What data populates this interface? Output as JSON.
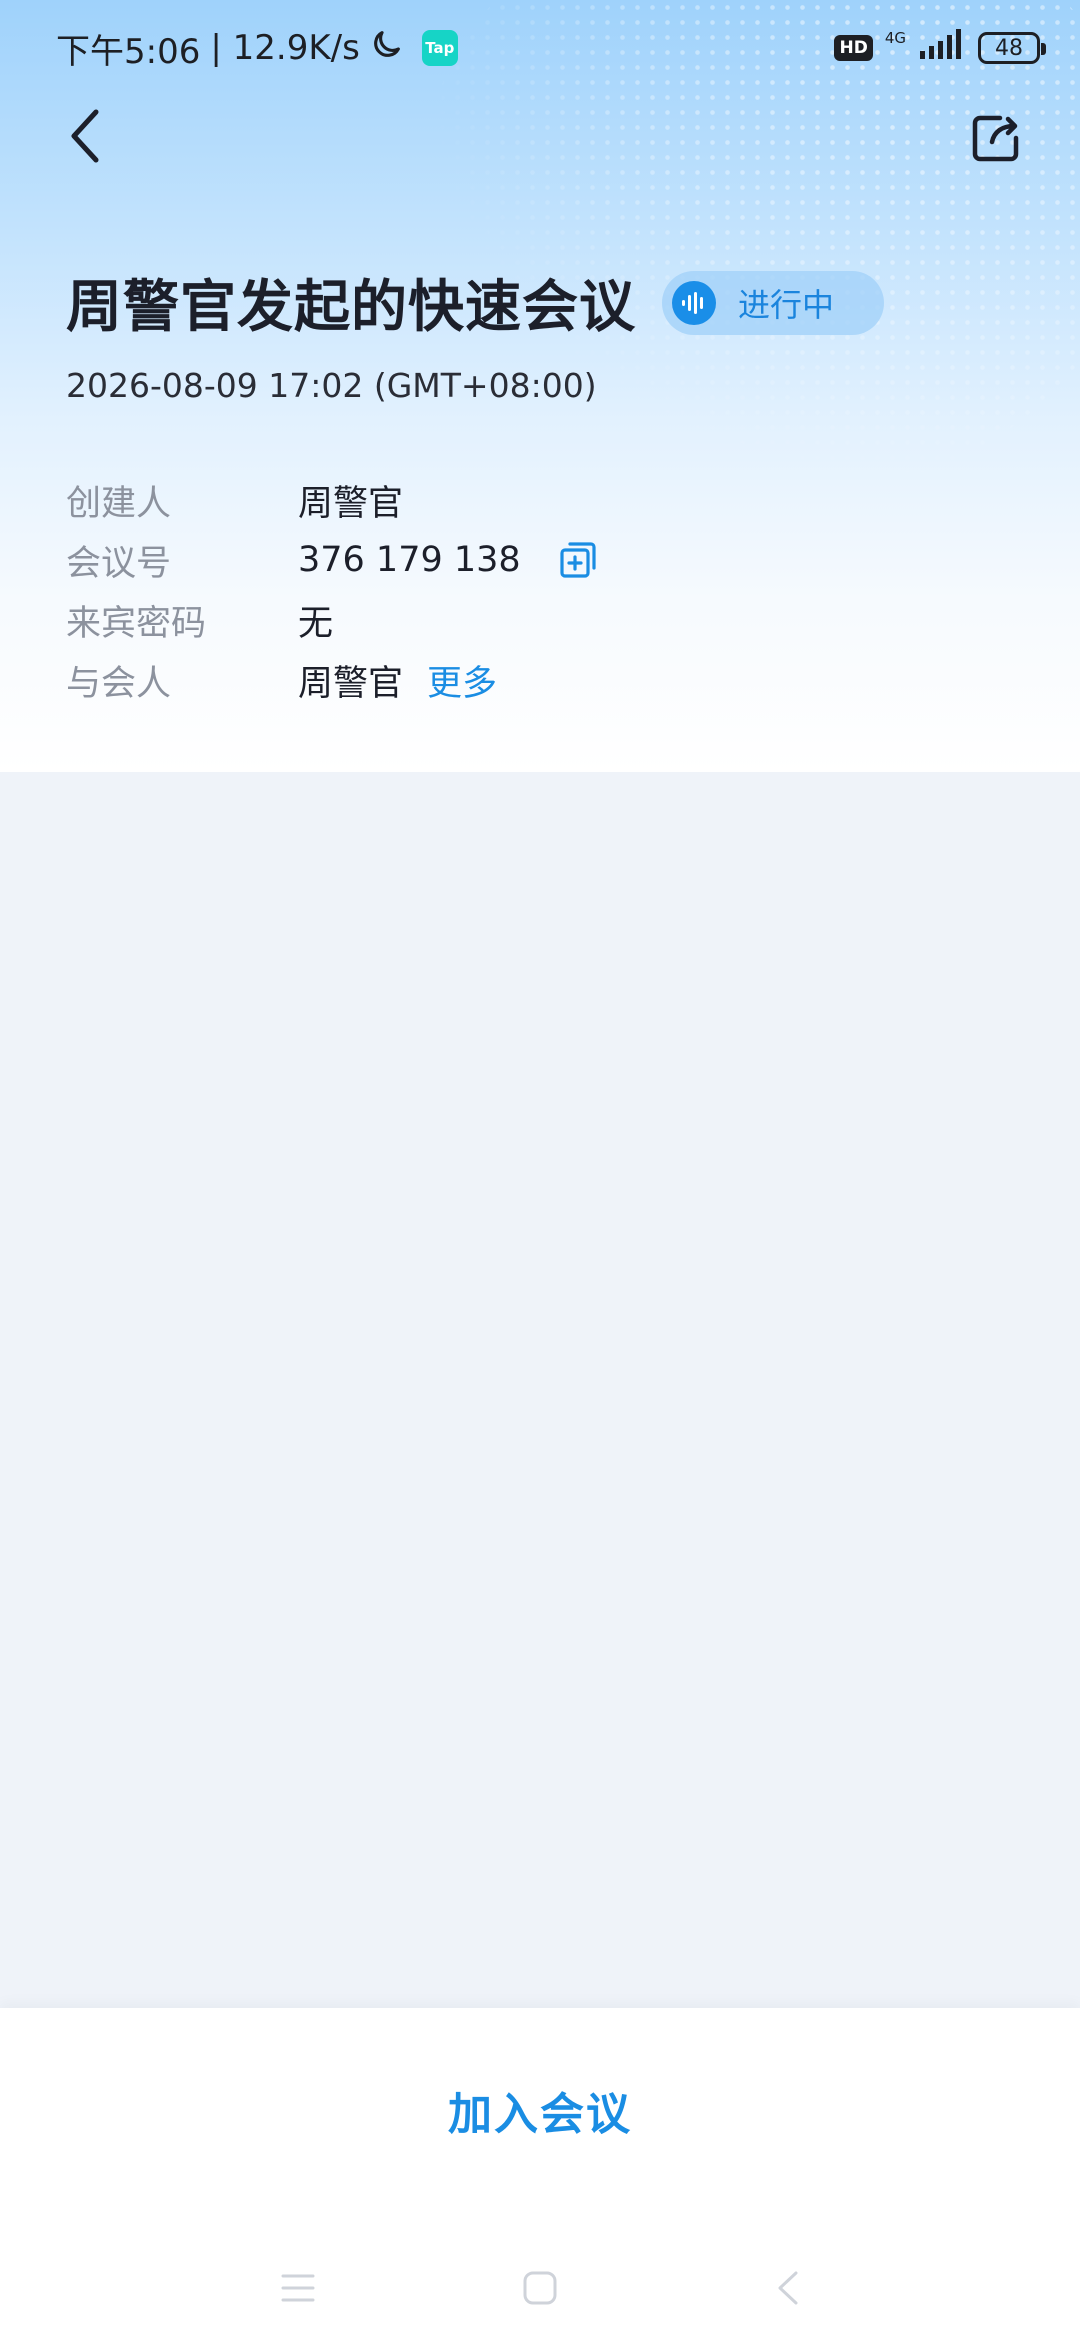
{
  "status_bar": {
    "time": "下午5:06",
    "speed": "| 12.9K/s",
    "tap_label": "Tap",
    "hd_label": "HD",
    "network": "4G",
    "battery": "48"
  },
  "meeting": {
    "title": "周警官发起的快速会议",
    "status": "进行中",
    "datetime": "2026-08-09 17:02 (GMT+08:00)"
  },
  "info": {
    "creator_label": "创建人",
    "creator_value": "周警官",
    "meeting_no_label": "会议号",
    "meeting_no_value": "376 179 138",
    "password_label": "来宾密码",
    "password_value": "无",
    "attendees_label": "与会人",
    "attendees_value": "周警官",
    "more_label": "更多"
  },
  "actions": {
    "join_label": "加入会议"
  },
  "colors": {
    "accent": "#1a8de3",
    "title": "#1c1f2a",
    "label": "#8c929e",
    "background": "#eff3f9"
  },
  "icons": {
    "back": "chevron-left-icon",
    "share": "share-icon",
    "status": "audio-wave-icon",
    "copy": "copy-icon",
    "moon": "moon-icon"
  }
}
